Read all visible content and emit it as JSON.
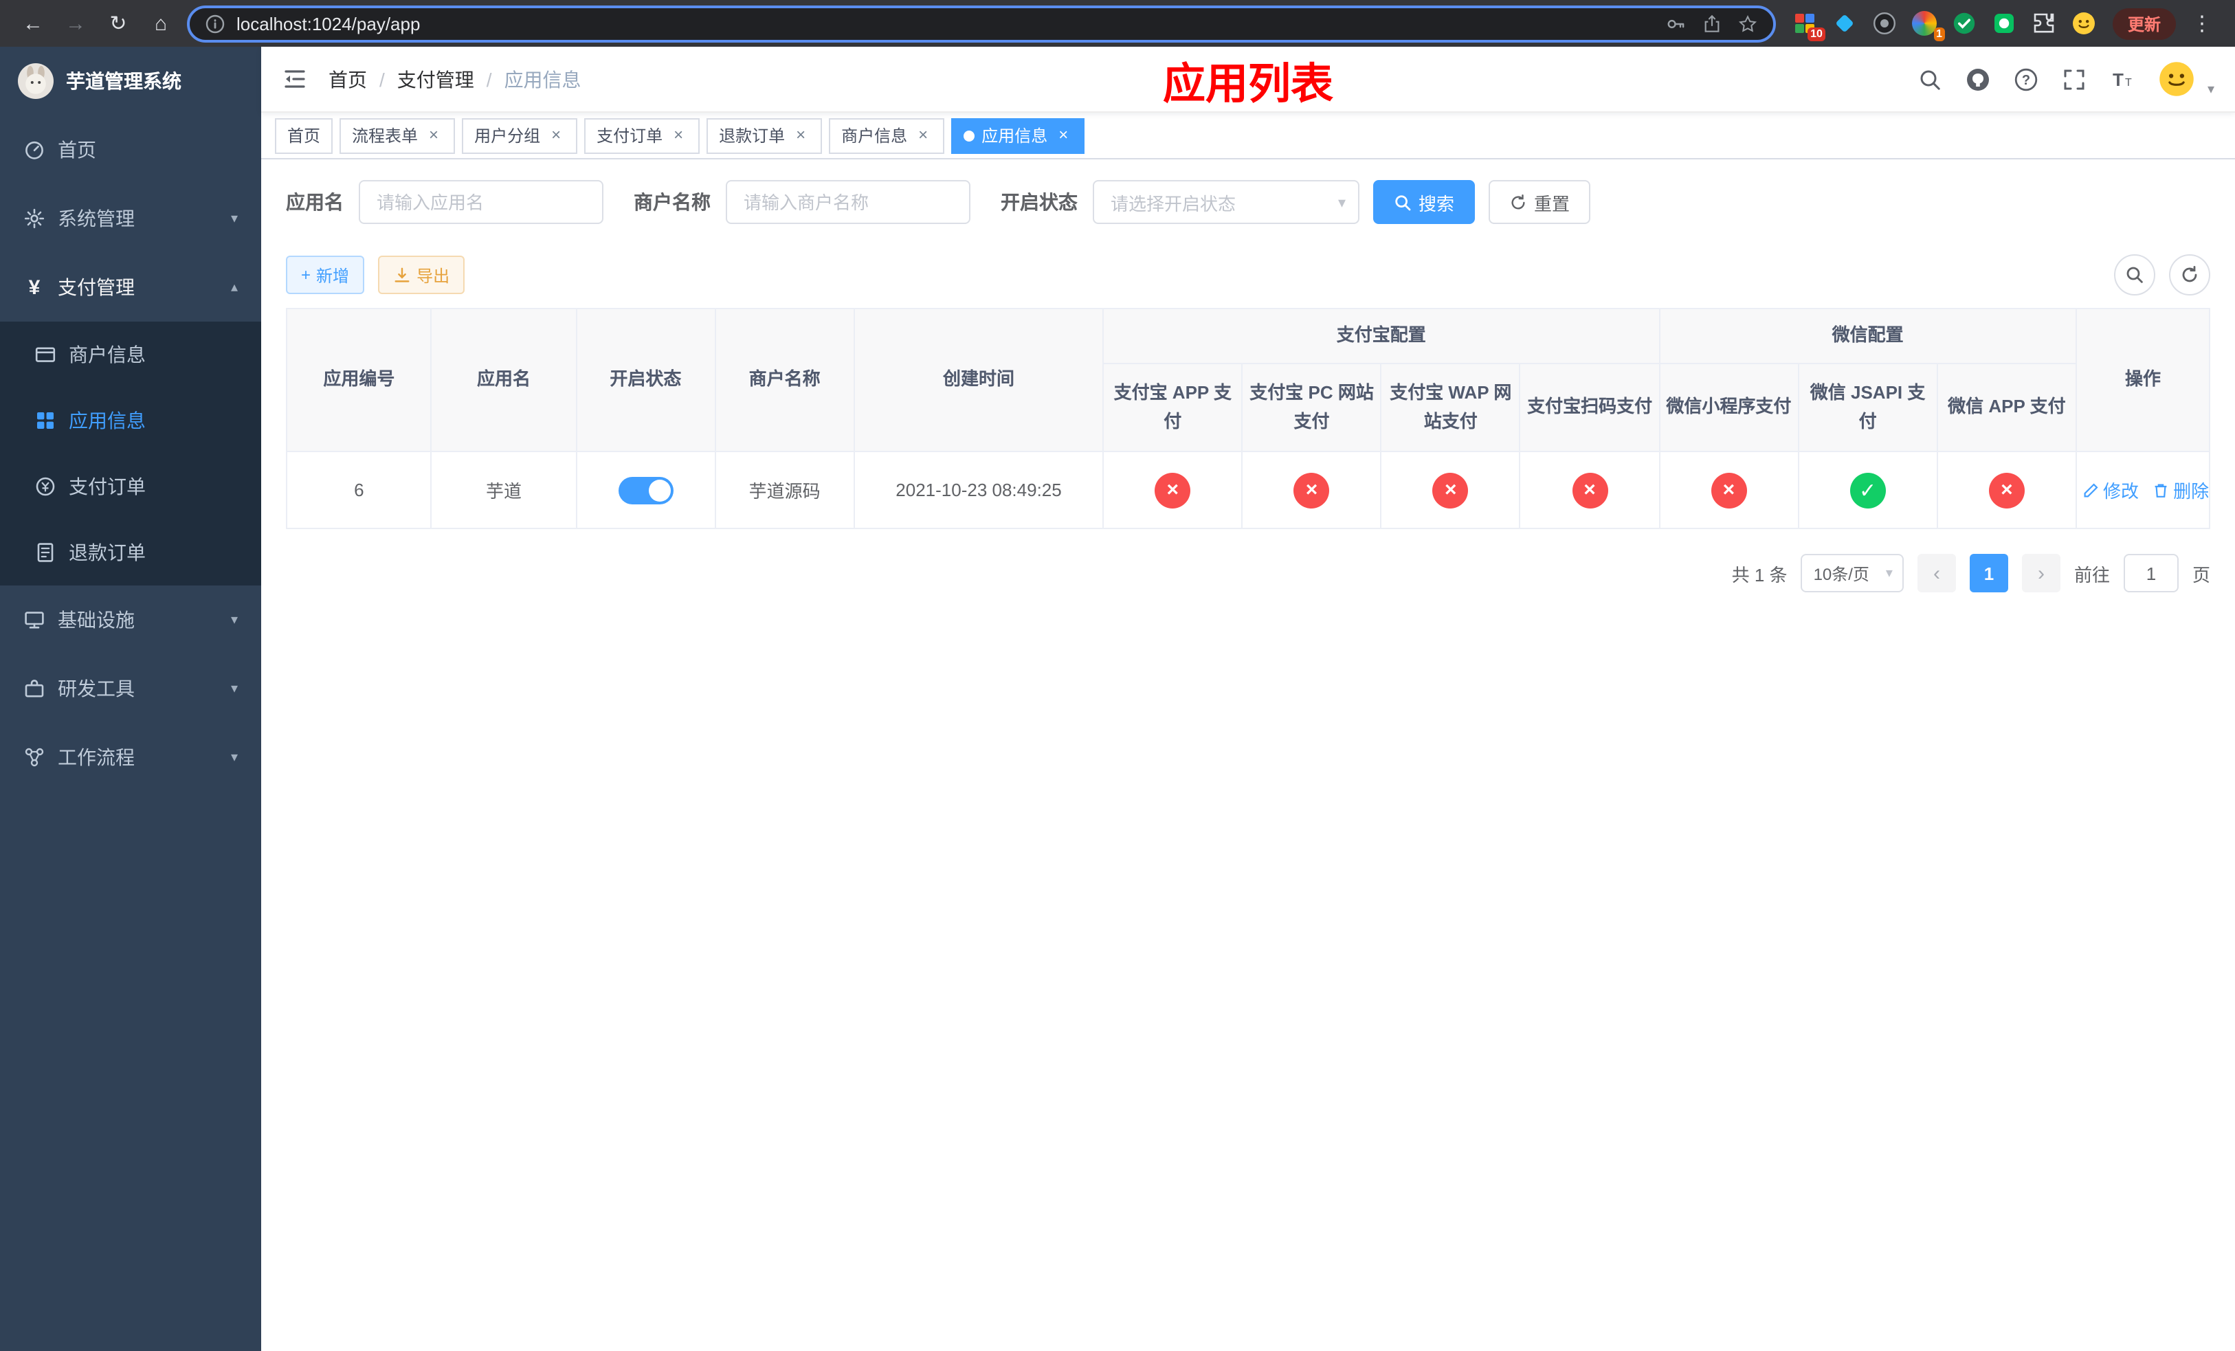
{
  "colors": {
    "primary": "#409eff",
    "danger": "#f94d4d",
    "success": "#12ce66",
    "warning": "#e6a23c",
    "sidebar_bg": "#304156",
    "submenu_bg": "#1f2d3d",
    "page_title_red": "#ff0000"
  },
  "icons": {
    "back": "arrow-left",
    "forward": "arrow-right",
    "reload": "refresh",
    "home": "house",
    "site_info": "info-circle",
    "key": "password-key",
    "share": "share-up",
    "bookmark": "star",
    "menu": "vertical-dots",
    "search": "magnifier",
    "github": "github-circle",
    "help": "question-circle",
    "fullscreen": "expand-corners",
    "font_size": "text-size",
    "hamburger": "menu-fold",
    "tab_close": "×",
    "caret_down": "▾",
    "caret_up": "▴",
    "check": "✓",
    "cross": "×",
    "prev": "‹",
    "next": "›",
    "edit": "pencil",
    "delete": "trash"
  },
  "browser": {
    "url": "localhost:1024/pay/app",
    "update_label": "更新",
    "extension_badges": {
      "grid": "10",
      "colorful": "1"
    }
  },
  "sidebar": {
    "title": "芋道管理系统",
    "items": [
      "首页",
      "系统管理",
      "支付管理",
      "基础设施",
      "研发工具",
      "工作流程"
    ],
    "pay_children": [
      "商户信息",
      "应用信息",
      "支付订单",
      "退款订单"
    ]
  },
  "header": {
    "breadcrumb": [
      "首页",
      "支付管理",
      "应用信息"
    ],
    "separator": "/",
    "page_title": "应用列表"
  },
  "tabs": {
    "labels": [
      "首页",
      "流程表单",
      "用户分组",
      "支付订单",
      "退款订单",
      "商户信息",
      "应用信息"
    ],
    "active": "应用信息"
  },
  "filters": {
    "app_name_label": "应用名",
    "app_name_placeholder": "请输入应用名",
    "merchant_label": "商户名称",
    "merchant_placeholder": "请输入商户名称",
    "status_label": "开启状态",
    "status_placeholder": "请选择开启状态",
    "search_label": "搜索",
    "reset_label": "重置"
  },
  "toolbar": {
    "add_label": "新增",
    "export_label": "导出"
  },
  "table": {
    "headers": {
      "app_id": "应用编号",
      "app_name": "应用名",
      "status": "开启状态",
      "merchant_name": "商户名称",
      "create_time": "创建时间",
      "alipay_group": "支付宝配置",
      "wechat_group": "微信配置",
      "channels": [
        "支付宝 APP 支付",
        "支付宝 PC 网站支付",
        "支付宝 WAP 网站支付",
        "支付宝扫码支付",
        "微信小程序支付",
        "微信 JSAPI 支付",
        "微信 APP 支付"
      ],
      "actions": "操作"
    },
    "rows": [
      {
        "app_id": "6",
        "app_name": "芋道",
        "enabled": true,
        "merchant_name": "芋道源码",
        "create_time": "2021-10-23 08:49:25",
        "channels": [
          false,
          false,
          false,
          false,
          false,
          true,
          false
        ],
        "edit": "修改",
        "delete": "删除"
      }
    ]
  },
  "pagination": {
    "total": "共 1 条",
    "page_size": "10条/页",
    "page": "1",
    "goto_label": "前往",
    "goto_value": "1",
    "goto_unit": "页"
  }
}
